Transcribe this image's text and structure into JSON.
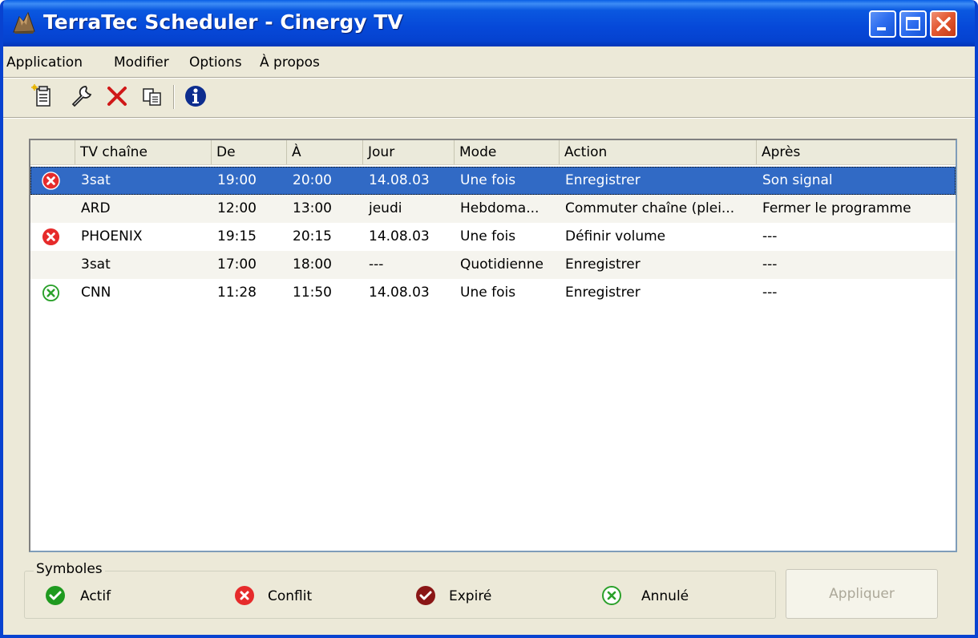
{
  "window": {
    "title": "TerraTec Scheduler - Cinergy TV",
    "colors": {
      "titlebar": "#0a58e0",
      "close_button": "#e35932",
      "selection": "#316ac5"
    }
  },
  "menu": [
    {
      "label": "Application"
    },
    {
      "label": "Modifier"
    },
    {
      "label": "Options"
    },
    {
      "label": "À propos"
    }
  ],
  "toolbar": [
    {
      "icon": "new-document-icon"
    },
    {
      "icon": "wrench-icon"
    },
    {
      "icon": "delete-x-icon"
    },
    {
      "icon": "copy-icon"
    },
    {
      "icon": "info-icon"
    }
  ],
  "columns": [
    "",
    "TV chaîne",
    "De",
    "À",
    "Jour",
    "Mode",
    "Action",
    "Après"
  ],
  "rows": [
    {
      "status": "conflict",
      "channel": "3sat",
      "from": "19:00",
      "to": "20:00",
      "day": "14.08.03",
      "mode": "Une fois",
      "action": "Enregistrer",
      "after": "Son signal",
      "selected": true
    },
    {
      "status": "none",
      "channel": "ARD",
      "from": "12:00",
      "to": "13:00",
      "day": "jeudi",
      "mode": "Hebdoma...",
      "action": "Commuter chaîne (plei...",
      "after": "Fermer le programme",
      "selected": false
    },
    {
      "status": "conflict",
      "channel": "PHOENIX",
      "from": "19:15",
      "to": "20:15",
      "day": "14.08.03",
      "mode": "Une fois",
      "action": "Définir volume",
      "after": "---",
      "selected": false
    },
    {
      "status": "none",
      "channel": "3sat",
      "from": "17:00",
      "to": "18:00",
      "day": "---",
      "mode": "Quotidienne",
      "action": "Enregistrer",
      "after": "---",
      "selected": false
    },
    {
      "status": "cancelled",
      "channel": "CNN",
      "from": "11:28",
      "to": "11:50",
      "day": "14.08.03",
      "mode": "Une fois",
      "action": "Enregistrer",
      "after": "---",
      "selected": false
    }
  ],
  "symbols": {
    "title": "Symboles",
    "items": [
      {
        "label": "Actif",
        "icon": "active-check-icon"
      },
      {
        "label": "Conflit",
        "icon": "conflict-x-icon"
      },
      {
        "label": "Expiré",
        "icon": "expired-check-icon"
      },
      {
        "label": "Annulé",
        "icon": "cancelled-x-icon"
      }
    ]
  },
  "apply_button": "Appliquer"
}
